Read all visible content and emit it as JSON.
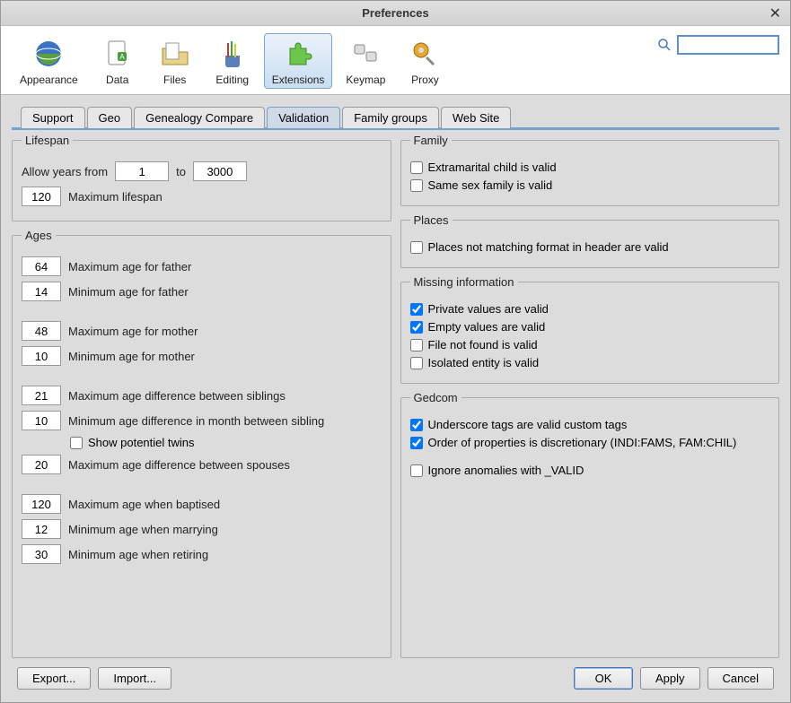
{
  "window": {
    "title": "Preferences"
  },
  "toolbar": {
    "items": [
      {
        "label": "Appearance"
      },
      {
        "label": "Data"
      },
      {
        "label": "Files"
      },
      {
        "label": "Editing"
      },
      {
        "label": "Extensions"
      },
      {
        "label": "Keymap"
      },
      {
        "label": "Proxy"
      }
    ]
  },
  "search": {
    "placeholder": ""
  },
  "subtabs": {
    "items": [
      {
        "label": "Support"
      },
      {
        "label": "Geo"
      },
      {
        "label": "Genealogy Compare"
      },
      {
        "label": "Validation"
      },
      {
        "label": "Family groups"
      },
      {
        "label": "Web Site"
      }
    ]
  },
  "lifespan": {
    "legend": "Lifespan",
    "allow_label_a": "Allow years from",
    "from": "1",
    "allow_label_b": "to",
    "to": "3000",
    "max_lifespan": "120",
    "max_lifespan_label": "Maximum lifespan"
  },
  "ages": {
    "legend": "Ages",
    "rows": [
      {
        "val": "64",
        "label": "Maximum age for father"
      },
      {
        "val": "14",
        "label": "Minimum age for father"
      },
      {
        "val": "48",
        "label": "Maximum age for mother"
      },
      {
        "val": "10",
        "label": "Minimum age for mother"
      },
      {
        "val": "21",
        "label": "Maximum age difference between siblings"
      },
      {
        "val": "10",
        "label": "Minimum age difference in month between sibling"
      },
      {
        "val": "20",
        "label": "Maximum age difference between spouses"
      },
      {
        "val": "120",
        "label": "Maximum age when baptised"
      },
      {
        "val": "12",
        "label": "Minimum age when marrying"
      },
      {
        "val": "30",
        "label": "Minimum age when retiring"
      }
    ],
    "twins_label": "Show potentiel twins"
  },
  "family": {
    "legend": "Family",
    "items": [
      {
        "label": "Extramarital child is valid",
        "checked": false
      },
      {
        "label": "Same sex family is valid",
        "checked": false
      }
    ]
  },
  "places": {
    "legend": "Places",
    "items": [
      {
        "label": "Places not matching format in header are valid",
        "checked": false
      }
    ]
  },
  "missing": {
    "legend": "Missing information",
    "items": [
      {
        "label": "Private values are valid",
        "checked": true
      },
      {
        "label": "Empty values are valid",
        "checked": true
      },
      {
        "label": "File not found is valid",
        "checked": false
      },
      {
        "label": "Isolated entity is valid",
        "checked": false
      }
    ]
  },
  "gedcom": {
    "legend": "Gedcom",
    "items": [
      {
        "label": "Underscore tags are valid custom tags",
        "checked": true
      },
      {
        "label": "Order of properties is discretionary (INDI:FAMS, FAM:CHIL)",
        "checked": true
      },
      {
        "label": "Ignore anomalies with _VALID",
        "checked": false
      }
    ]
  },
  "footer": {
    "export": "Export...",
    "import": "Import...",
    "ok": "OK",
    "apply": "Apply",
    "cancel": "Cancel"
  }
}
